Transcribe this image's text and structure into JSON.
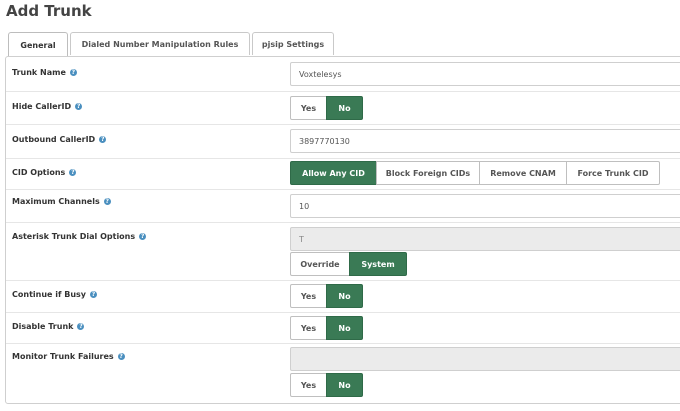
{
  "page": {
    "title": "Add Trunk"
  },
  "tabs": [
    {
      "label": "General"
    },
    {
      "label": "Dialed Number Manipulation Rules"
    },
    {
      "label": "pjsip Settings"
    }
  ],
  "fields": {
    "trunk_name": {
      "label": "Trunk Name",
      "value": "Voxtelesys"
    },
    "hide_callerid": {
      "label": "Hide CallerID",
      "options": [
        "Yes",
        "No"
      ],
      "selected": "No"
    },
    "outbound_callerid": {
      "label": "Outbound CallerID",
      "value": "3897770130"
    },
    "cid_options": {
      "label": "CID Options",
      "options": [
        "Allow Any CID",
        "Block Foreign CIDs",
        "Remove CNAM",
        "Force Trunk CID"
      ],
      "selected": "Allow Any CID"
    },
    "maximum_channels": {
      "label": "Maximum Channels",
      "value": "10"
    },
    "asterisk_dial_options": {
      "label": "Asterisk Trunk Dial Options",
      "value": "T",
      "options": [
        "Override",
        "System"
      ],
      "selected": "System"
    },
    "continue_if_busy": {
      "label": "Continue if Busy",
      "options": [
        "Yes",
        "No"
      ],
      "selected": "No"
    },
    "disable_trunk": {
      "label": "Disable Trunk",
      "options": [
        "Yes",
        "No"
      ],
      "selected": "No"
    },
    "monitor_trunk_failures": {
      "label": "Monitor Trunk Failures",
      "value": "",
      "options": [
        "Yes",
        "No"
      ],
      "selected": "No"
    }
  },
  "colors": {
    "accent": "#3a7a55",
    "help": "#4a8fbf"
  }
}
